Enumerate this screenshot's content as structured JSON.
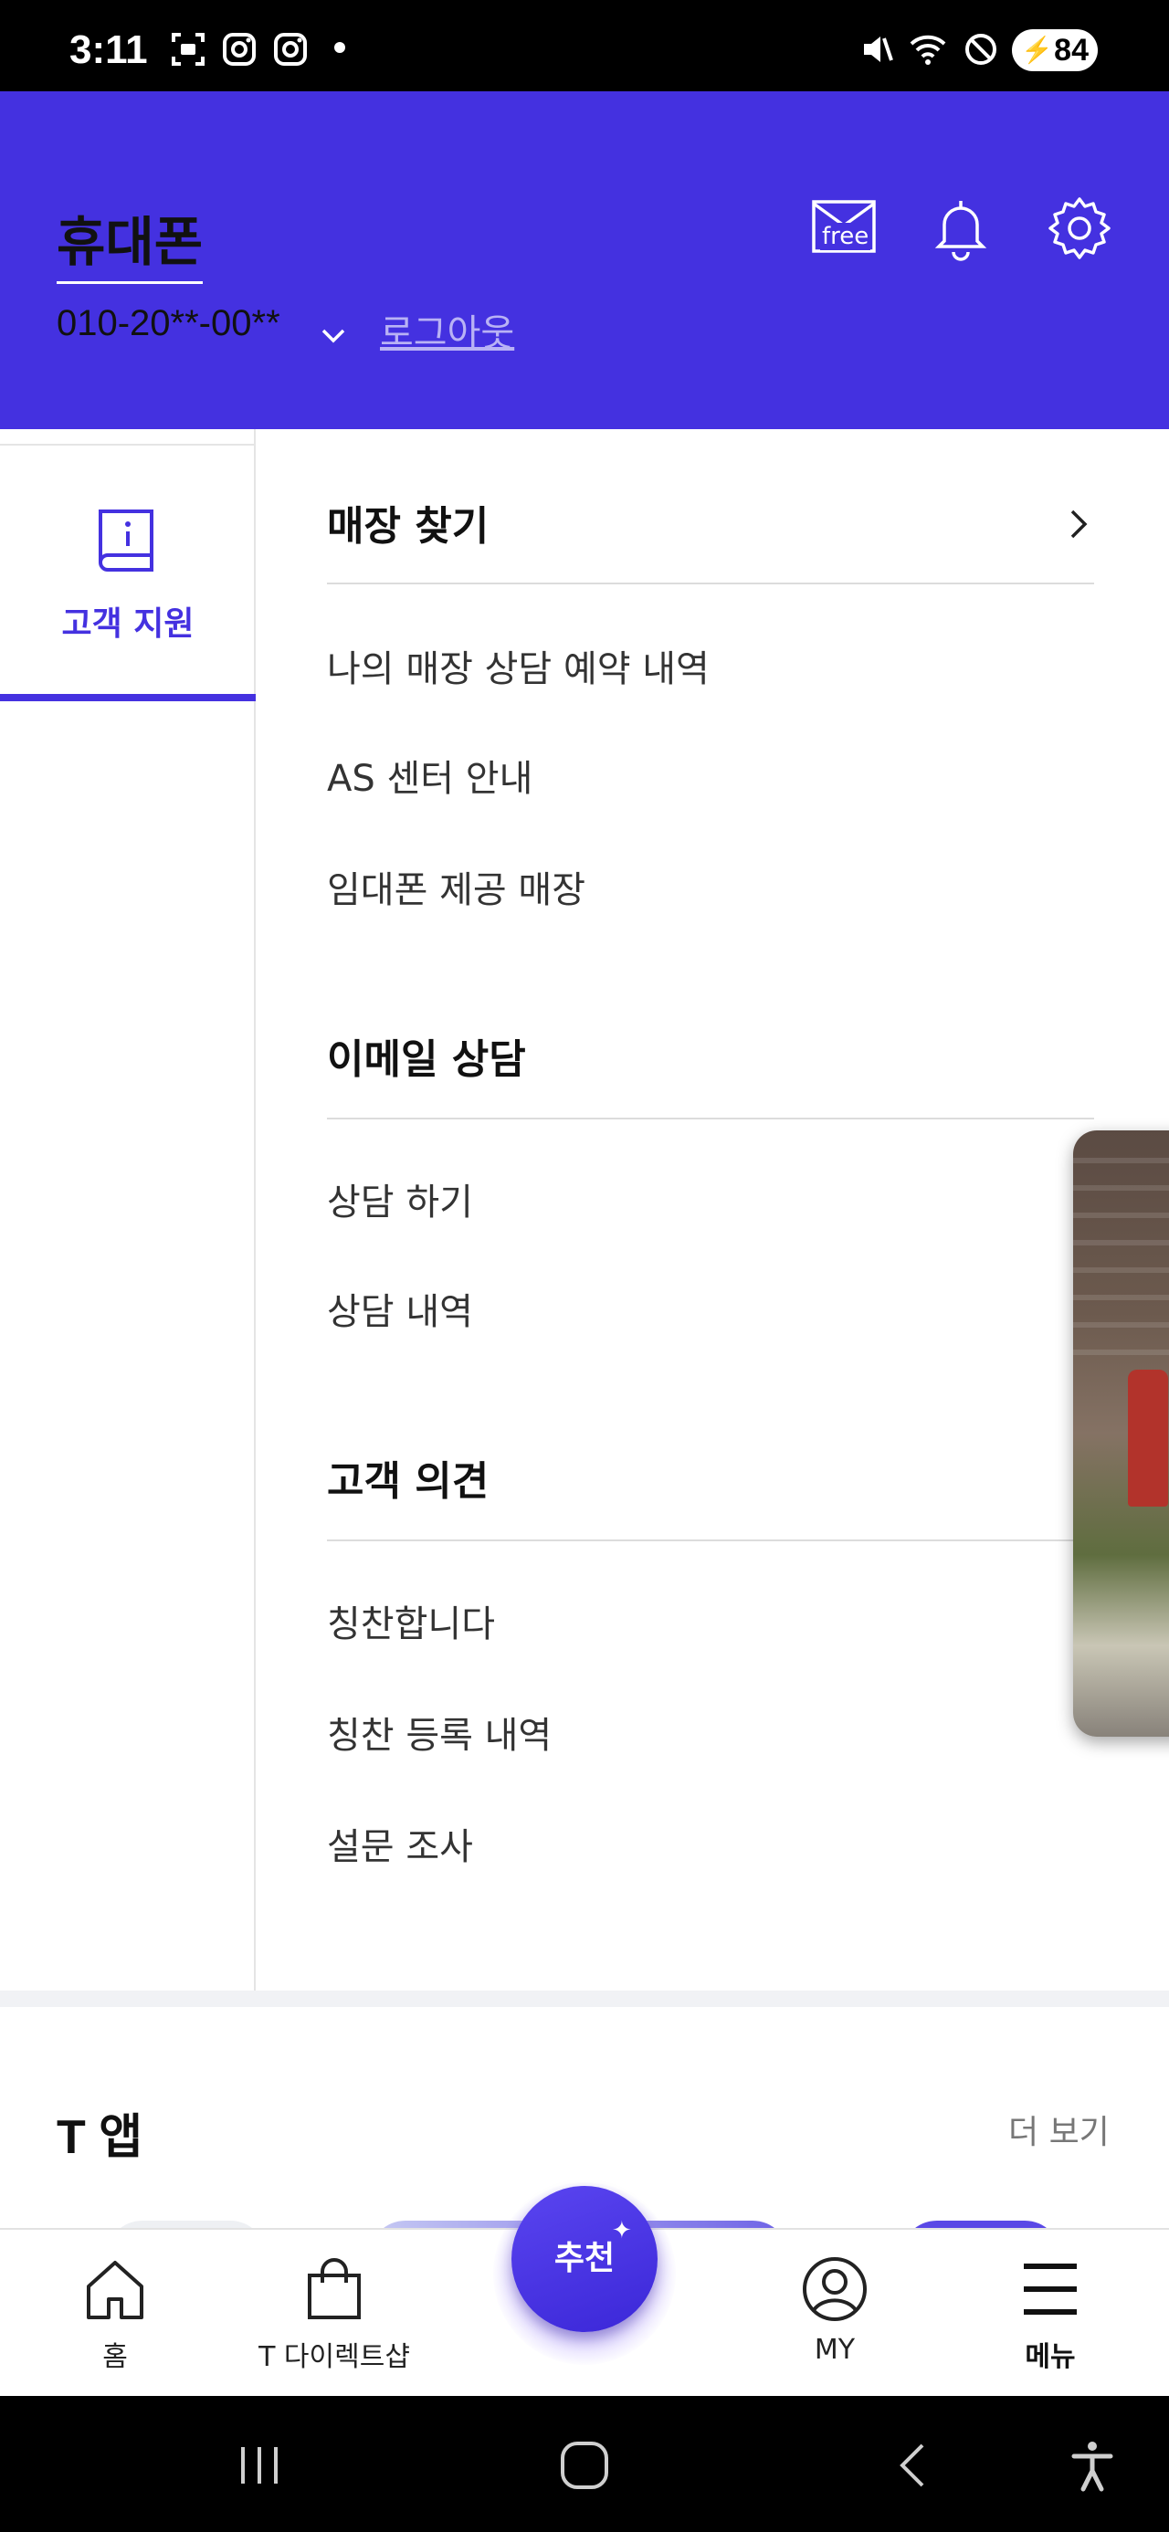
{
  "status_bar": {
    "time": "3:11",
    "battery": "84"
  },
  "header": {
    "title": "휴대폰",
    "phone_number": "010-20**-00**",
    "logout": "로그아웃",
    "mail_badge": "free"
  },
  "left_nav": {
    "active_label": "고객 지원"
  },
  "sections": [
    {
      "title": "매장 찾기",
      "items": [
        "나의 매장 상담 예약 내역",
        "AS 센터 안내",
        "임대폰 제공 매장"
      ]
    },
    {
      "title": "이메일 상담",
      "items": [
        "상담 하기",
        "상담 내역"
      ]
    },
    {
      "title": "고객 의견",
      "items": [
        "칭찬합니다",
        "칭찬 등록 내역",
        "설문 조사"
      ]
    }
  ],
  "t_app": {
    "title": "T 앱",
    "more": "더 보기"
  },
  "bottom_nav": {
    "home": "홈",
    "shop": "T 다이렉트샵",
    "recommend": "추천",
    "my": "MY",
    "menu": "메뉴"
  },
  "colors": {
    "brand": "#4431e0",
    "header_bg": "#4431e0"
  }
}
